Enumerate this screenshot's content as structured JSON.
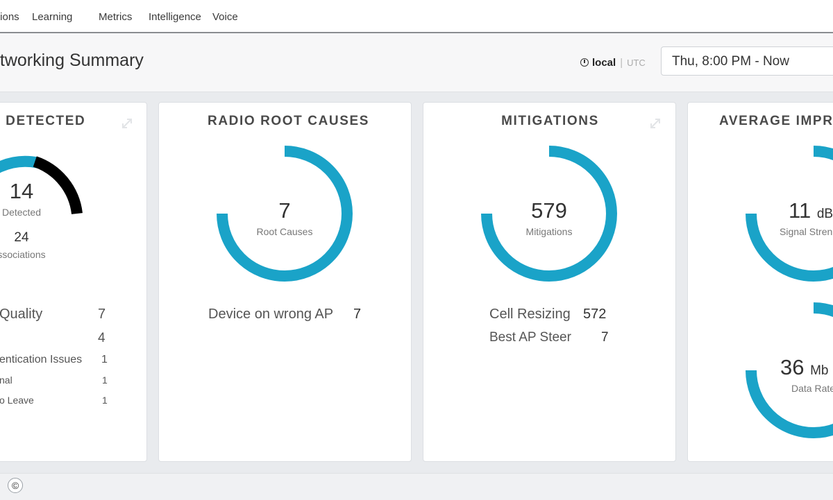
{
  "nav": {
    "items": [
      "tions",
      "Learning",
      "Metrics",
      "Intelligence",
      "Voice"
    ]
  },
  "header": {
    "title": "etworking Summary",
    "tz_local": "local",
    "tz_utc": "UTC",
    "time_range": "Thu, 8:00 PM - Now"
  },
  "cards": {
    "detected": {
      "title": "S DETECTED",
      "main_value": "14",
      "main_label": "Detected",
      "second_value": "24",
      "second_label": "ssociations",
      "rows": [
        {
          "label": "Quality",
          "value": "7"
        },
        {
          "label": "",
          "value": "4"
        },
        {
          "label": "entication Issues",
          "value": "1"
        },
        {
          "label": "nal",
          "value": "1"
        },
        {
          "label": "o Leave",
          "value": "1"
        }
      ]
    },
    "root_causes": {
      "title": "RADIO ROOT CAUSES",
      "value": "7",
      "label": "Root Causes",
      "rows": [
        {
          "label": "Device on wrong AP",
          "value": "7"
        }
      ]
    },
    "mitigations": {
      "title": "MITIGATIONS",
      "value": "579",
      "label": "Mitigations",
      "rows": [
        {
          "label": "Cell Resizing",
          "value": "572"
        },
        {
          "label": "Best AP Steer",
          "value": "7"
        }
      ]
    },
    "improvement": {
      "title": "AVERAGE IMPRO",
      "signal_value": "11",
      "signal_unit": "dB",
      "signal_label": "Signal Stren",
      "rate_value": "36",
      "rate_unit": "Mb",
      "rate_label": "Data Rate"
    }
  },
  "colors": {
    "gauge": "#1aa3c8",
    "gauge_dark": "#000000"
  },
  "footer": {
    "help_icon": "©"
  }
}
